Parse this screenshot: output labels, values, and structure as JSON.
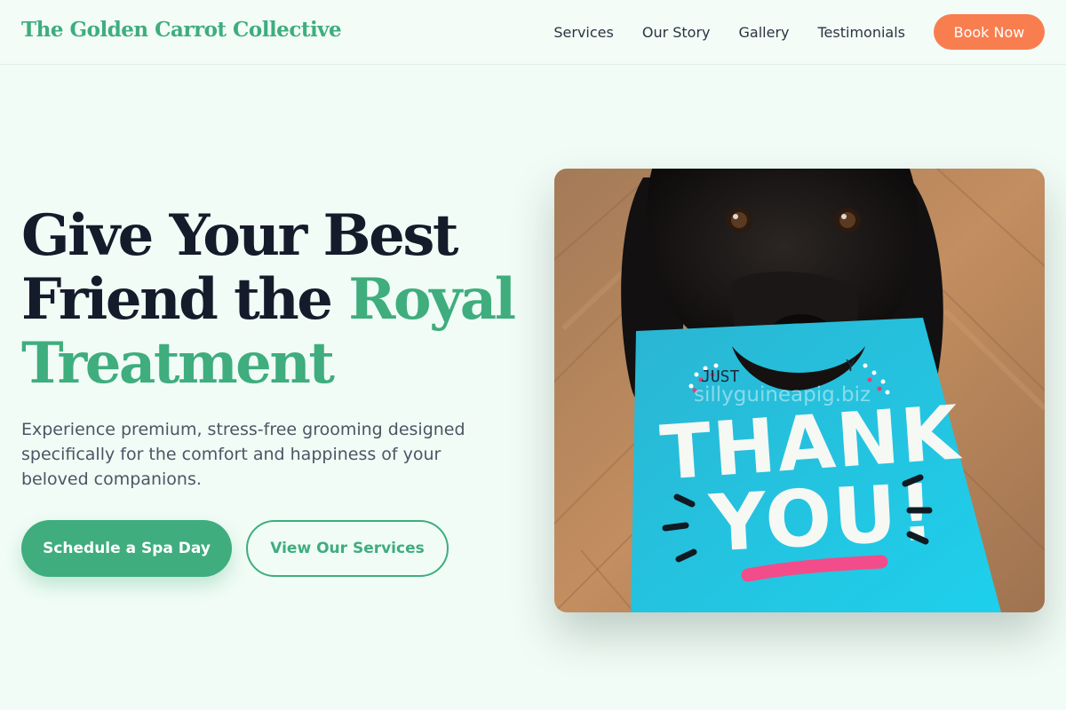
{
  "header": {
    "brand": "The Golden Carrot Collective",
    "nav": {
      "services": "Services",
      "our_story": "Our Story",
      "gallery": "Gallery",
      "testimonials": "Testimonials"
    },
    "cta": "Book Now"
  },
  "hero": {
    "title_line1": "Give Your Best",
    "title_line2_start": "Friend the ",
    "title_line2_accent": "Royal",
    "title_line3_accent": "Treatment",
    "subtitle": "Experience premium, stress-free grooming designed specifically for the comfort and happiness of your beloved companions.",
    "primary_button": "Schedule a Spa Day",
    "secondary_button": "View Our Services",
    "image": {
      "card_text_top": "JUST",
      "card_text_top_right": "Y",
      "card_text_main1": "THANK",
      "card_text_main2": "YOU!",
      "watermark": "sillyguineapig.biz"
    }
  },
  "colors": {
    "brand_green": "#3fad7e",
    "cta_orange": "#f97e4f",
    "heading_dark": "#141c2b",
    "background": "#f1fcf6"
  }
}
